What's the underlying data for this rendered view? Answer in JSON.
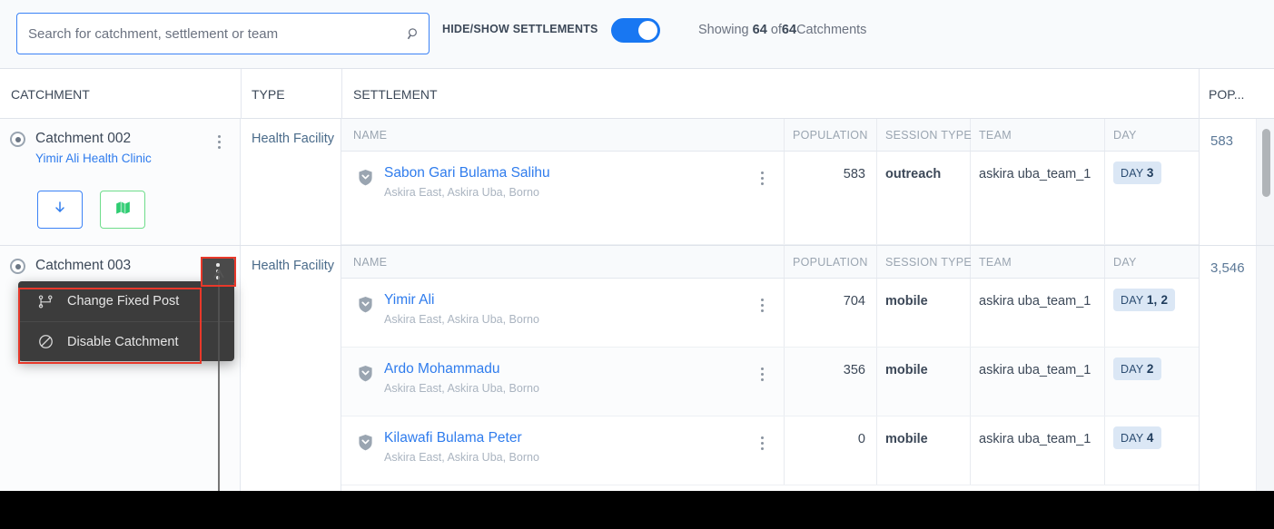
{
  "toolbar": {
    "search_placeholder": "Search for catchment, settlement or team",
    "search_value": "",
    "search_icon": "search-icon",
    "toggle_label": "HIDE/SHOW SETTLEMENTS",
    "toggle_on": true,
    "showing_prefix": "Showing",
    "showing_count": "64",
    "showing_of": "of",
    "showing_total": "64",
    "showing_suffix": "Catchments"
  },
  "columns": {
    "catchment": "CATCHMENT",
    "type": "TYPE",
    "settlement": "SETTLEMENT",
    "population": "POP..."
  },
  "settlement_columns": {
    "name": "NAME",
    "population": "POPULATION",
    "session_type": "SESSION TYPE",
    "team": "TEAM",
    "day": "DAY"
  },
  "catchments": [
    {
      "name": "Catchment 002",
      "facility": "Yimir Ali Health Clinic",
      "type": "Health Facility",
      "population": "583",
      "download_icon": "download-arrow-icon",
      "map_icon": "map-icon",
      "settlements": [
        {
          "name": "Sabon Gari Bulama Salihu",
          "location": "Askira East, Askira Uba, Borno",
          "population": "583",
          "session_type": "outreach",
          "team": "askira uba_team_1",
          "day_prefix": "DAY",
          "day_value": "3"
        }
      ]
    },
    {
      "name": "Catchment 003",
      "facility": "",
      "type": "Health Facility",
      "population": "3,546",
      "settlements": [
        {
          "name": "Yimir Ali",
          "location": "Askira East, Askira Uba, Borno",
          "population": "704",
          "session_type": "mobile",
          "team": "askira uba_team_1",
          "day_prefix": "DAY",
          "day_value": "1, 2"
        },
        {
          "name": "Ardo Mohammadu",
          "location": "Askira East, Askira Uba, Borno",
          "population": "356",
          "session_type": "mobile",
          "team": "askira uba_team_1",
          "day_prefix": "DAY",
          "day_value": "2"
        },
        {
          "name": "Kilawafi Bulama Peter",
          "location": "Askira East, Askira Uba, Borno",
          "population": "0",
          "session_type": "mobile",
          "team": "askira uba_team_1",
          "day_prefix": "DAY",
          "day_value": "4"
        }
      ]
    }
  ],
  "context_menu": {
    "items": [
      {
        "label": "Change Fixed Post",
        "icon": "sitemap-icon"
      },
      {
        "label": "Disable Catchment",
        "icon": "ban-icon"
      }
    ]
  },
  "colors": {
    "accent_blue": "#2f7ced",
    "toggle_blue": "#1877f2",
    "map_green": "#2ecc71",
    "menu_dark": "#3c3c3c",
    "annotation_red": "#e8382a",
    "day_badge_bg": "#dbe7f5"
  }
}
